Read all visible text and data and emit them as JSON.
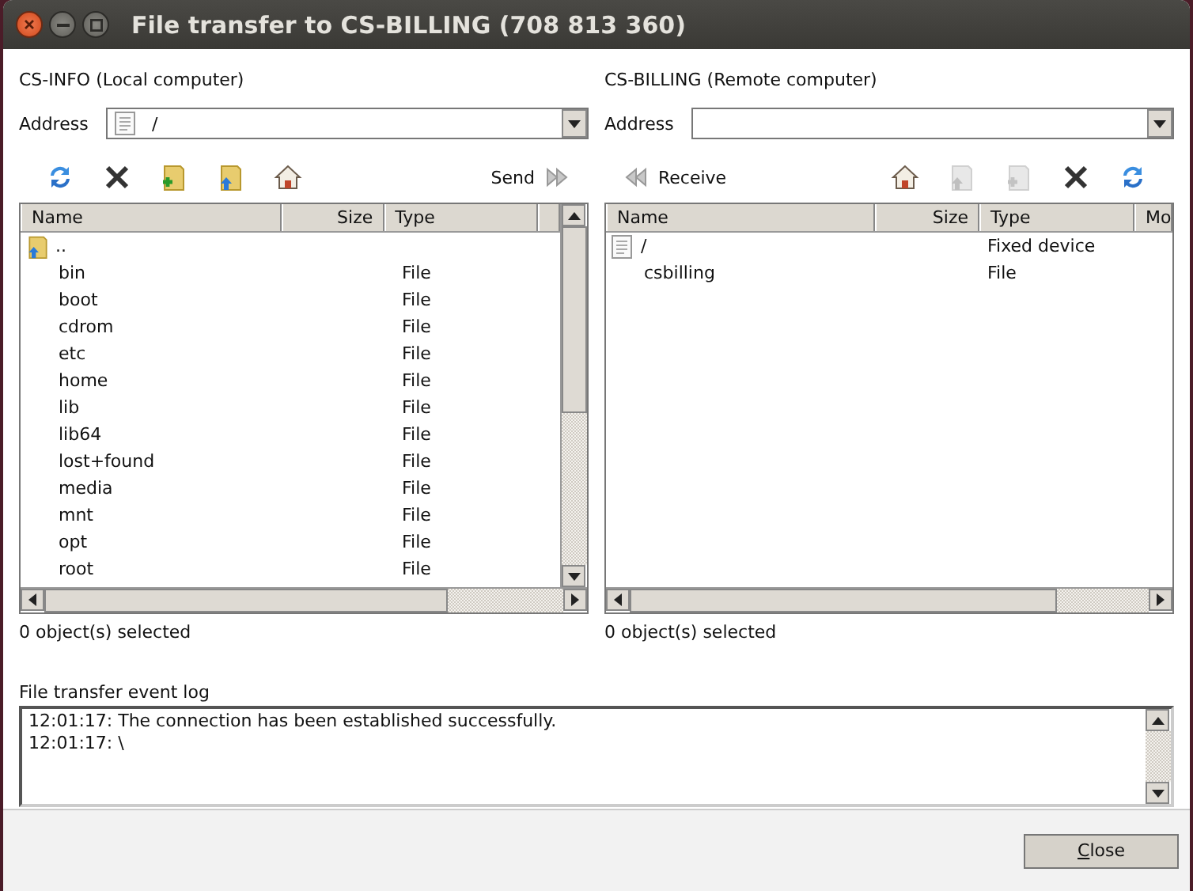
{
  "window": {
    "title": "File transfer to CS-BILLING (708 813 360)"
  },
  "panels": [
    {
      "heading": "CS-INFO (Local computer)",
      "address_label": "Address",
      "address": {
        "value": "/"
      },
      "toolbar": [
        {
          "kind": "refresh",
          "disabled": false
        },
        {
          "kind": "delete",
          "disabled": false
        },
        {
          "kind": "new-folder",
          "disabled": false
        },
        {
          "kind": "parent-folder",
          "disabled": false
        },
        {
          "kind": "home",
          "disabled": false
        },
        {
          "kind": "transfer",
          "label": "Send",
          "disabled": false
        }
      ],
      "columns": [
        "Name",
        "Size",
        "Type"
      ],
      "rows": [
        {
          "name": "..",
          "kind": "parent"
        },
        {
          "name": "bin",
          "type": "File"
        },
        {
          "name": "boot",
          "type": "File"
        },
        {
          "name": "cdrom",
          "type": "File"
        },
        {
          "name": "etc",
          "type": "File"
        },
        {
          "name": "home",
          "type": "File"
        },
        {
          "name": "lib",
          "type": "File"
        },
        {
          "name": "lib64",
          "type": "File"
        },
        {
          "name": "lost+found",
          "type": "File"
        },
        {
          "name": "media",
          "type": "File"
        },
        {
          "name": "mnt",
          "type": "File"
        },
        {
          "name": "opt",
          "type": "File"
        },
        {
          "name": "root",
          "type": "File"
        }
      ],
      "status": "0 object(s) selected"
    },
    {
      "heading": "CS-BILLING (Remote computer)",
      "address_label": "Address",
      "toolbar": [
        {
          "kind": "transfer",
          "label": "Receive",
          "disabled": false
        },
        {
          "kind": "home",
          "disabled": false
        },
        {
          "kind": "parent-folder",
          "disabled": true
        },
        {
          "kind": "new-folder",
          "disabled": true
        },
        {
          "kind": "delete",
          "disabled": false
        },
        {
          "kind": "refresh",
          "disabled": false
        }
      ],
      "columns": [
        "Name",
        "Size",
        "Type",
        "Mo"
      ],
      "rows": [
        {
          "name": "/",
          "type": "Fixed device",
          "kind": "drive"
        },
        {
          "name": "csbilling",
          "type": "File"
        }
      ],
      "status": "0 object(s) selected"
    }
  ],
  "log": {
    "label": "File transfer event log",
    "lines": [
      "12:01:17: The connection has been established successfully.",
      "12:01:17: \\"
    ]
  },
  "buttons": [
    {
      "label": "Close"
    }
  ]
}
